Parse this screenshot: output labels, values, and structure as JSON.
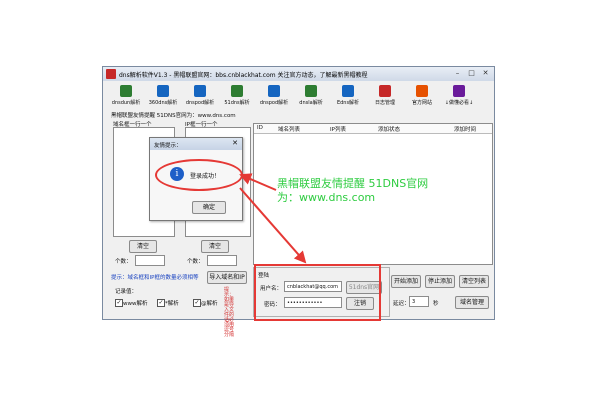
{
  "window": {
    "title": "dns解析软件V1.3 - 黑帽联盟官网：bbs.cnblackhat.com 关注官方动态，了解最新黑帽教程"
  },
  "toolbar": {
    "items": [
      {
        "label": "dnsdun解析",
        "icon": "globe-icon"
      },
      {
        "label": "360dns解析",
        "icon": "globe-icon"
      },
      {
        "label": "dnspod解析",
        "icon": "globe-icon"
      },
      {
        "label": "51dns解析",
        "icon": "globe-icon"
      },
      {
        "label": "dnspod解析",
        "icon": "globe-icon"
      },
      {
        "label": "dnsla解析",
        "icon": "globe-icon"
      },
      {
        "label": "Edns解析",
        "icon": "globe-icon"
      },
      {
        "label": "日志管理",
        "icon": "log-icon"
      },
      {
        "label": "官方网站",
        "icon": "home-icon"
      },
      {
        "label": "↓做懂必看↓",
        "icon": "book-icon"
      }
    ]
  },
  "notice": "黑帽联盟友情提醒 51DNS官网为：www.dns.com",
  "left": {
    "domain_header": "域名框一行一个",
    "ip_header": "IP框一行一个",
    "clear_label": "清空",
    "count_label": "个数：",
    "hint": "提示：域名框和IP框的数量必须相等",
    "import_label": "导入域名和IP",
    "record_label": "记录值：",
    "records": [
      "www解析",
      "*解析",
      "@解析"
    ],
    "side_hint": "提示：如果是导入文件的话必须用逗号分隔"
  },
  "table": {
    "columns": [
      "ID",
      "域名列表",
      "IP列表",
      "添加状态",
      "添加时间"
    ]
  },
  "login": {
    "group": "登陆",
    "username_label": "用户名：",
    "username_value": "cnblackhat@qq.com",
    "password_label": "密码：",
    "password_value": "••••••••••••",
    "site_btn": "51dns官网",
    "login_btn": "注销"
  },
  "actions": {
    "start": "开始添加",
    "stop": "停止添加",
    "clear_list": "清空列表",
    "delay_label": "延迟：",
    "delay_value": "3",
    "delay_unit": "秒",
    "domain_mgmt": "域名管理"
  },
  "dialog": {
    "title": "友情提示：",
    "message": "登录成功！",
    "ok": "确定"
  },
  "annotation": {
    "line1": "黑帽联盟友情提醒 51DNS官网",
    "line2": "为：www.dns.com"
  },
  "colors": {
    "accent_red": "#e53935",
    "annotation_green": "#2ecc40",
    "link_blue": "#1a43c0"
  }
}
